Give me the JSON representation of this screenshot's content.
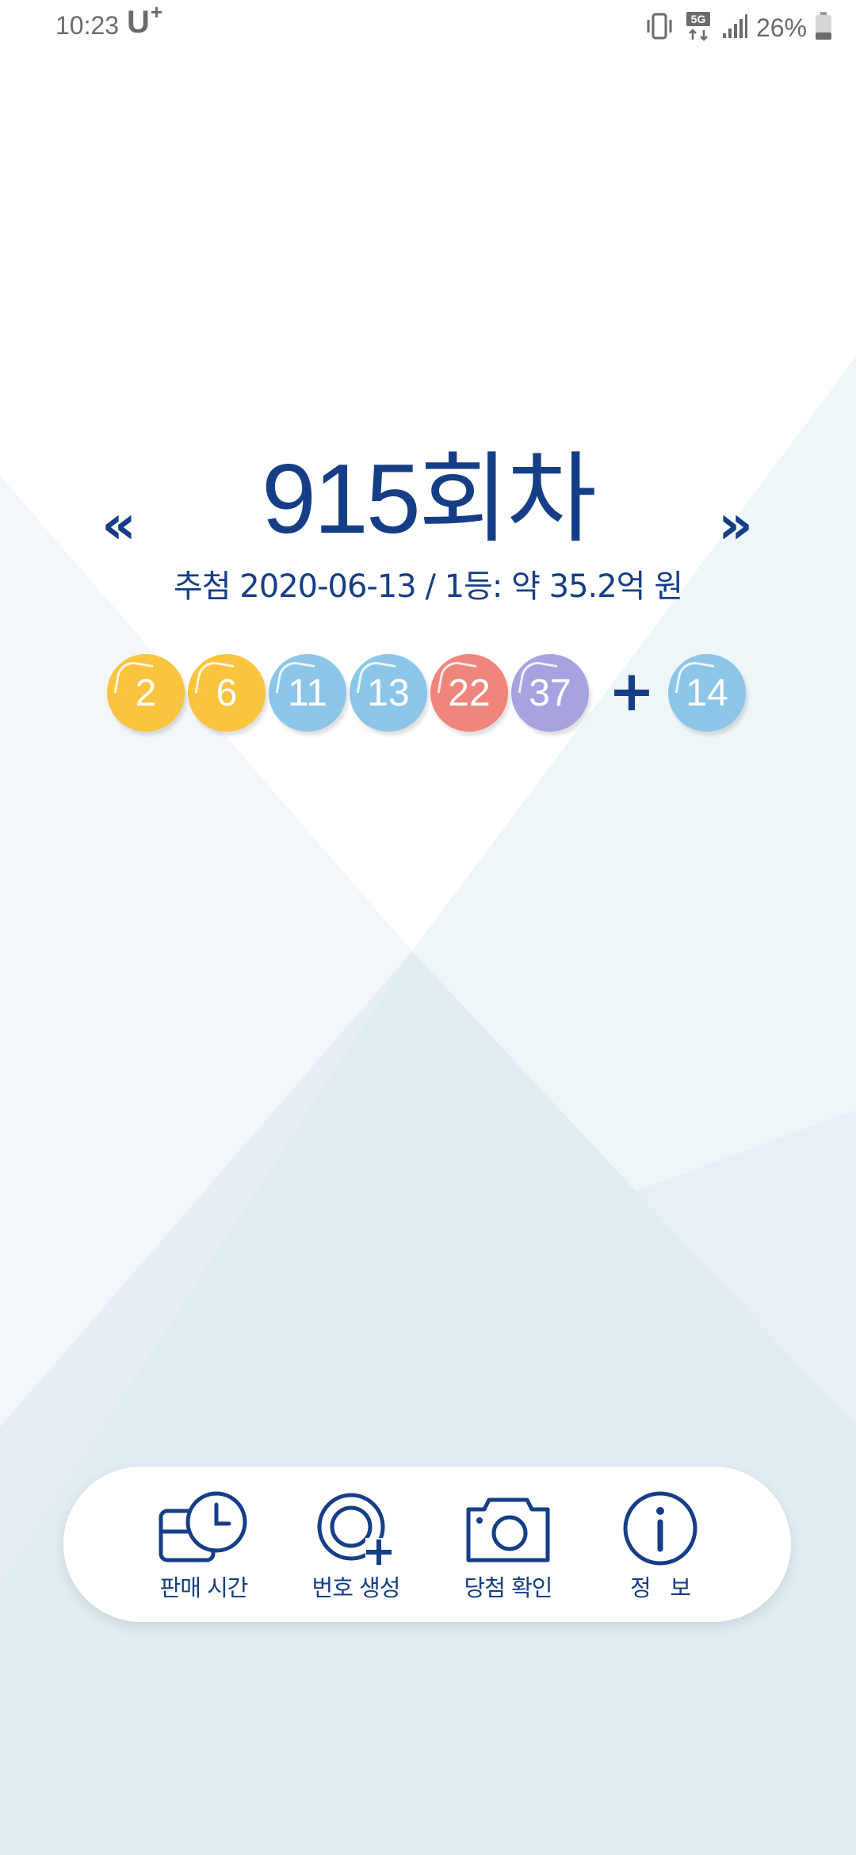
{
  "status_bar": {
    "time": "10:23",
    "carrier": "U",
    "carrier_sup": "+",
    "network": "5G",
    "battery": "26%",
    "icons": [
      "vibrate-icon",
      "5g-icon",
      "signal-icon",
      "battery-icon"
    ]
  },
  "lotto": {
    "round_title": "915회차",
    "prev_label": "«",
    "next_label": "»",
    "draw_info": "추첨 2020-06-13 / 1등: 약 35.2억 원",
    "plus": "+",
    "numbers": [
      {
        "value": "2",
        "color": "#fbc43f"
      },
      {
        "value": "6",
        "color": "#fbc43f"
      },
      {
        "value": "11",
        "color": "#8bc6e8"
      },
      {
        "value": "13",
        "color": "#8bc6e8"
      },
      {
        "value": "22",
        "color": "#f0857b"
      },
      {
        "value": "37",
        "color": "#a7a3e0"
      }
    ],
    "bonus": {
      "value": "14",
      "color": "#8bc6e8"
    }
  },
  "menu": {
    "items": [
      {
        "label": "판매 시간",
        "icon": "clock-calendar-icon"
      },
      {
        "label": "번호 생성",
        "icon": "add-circle-icon"
      },
      {
        "label": "당첨 확인",
        "icon": "camera-icon"
      },
      {
        "label": "정   보",
        "icon": "info-icon"
      }
    ]
  },
  "colors": {
    "primary": "#153e86",
    "ball_yellow": "#fbc43f",
    "ball_blue": "#8bc6e8",
    "ball_red": "#f0857b",
    "ball_purple": "#a7a3e0"
  }
}
